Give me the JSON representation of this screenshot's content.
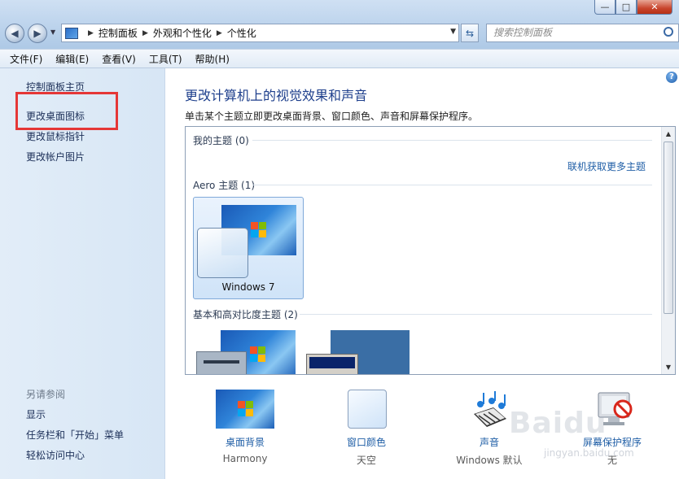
{
  "window": {
    "controls": [
      "—",
      "□",
      "✕"
    ]
  },
  "address": {
    "crumbs": [
      "控制面板",
      "外观和个性化",
      "个性化"
    ],
    "search_placeholder": "搜索控制面板"
  },
  "menubar": [
    "文件(F)",
    "编辑(E)",
    "查看(V)",
    "工具(T)",
    "帮助(H)"
  ],
  "sidebar": {
    "home": "控制面板主页",
    "links": [
      "更改桌面图标",
      "更改鼠标指针",
      "更改帐户图片"
    ],
    "see_also_heading": "另请参阅",
    "see_also": [
      "显示",
      "任务栏和「开始」菜单",
      "轻松访问中心"
    ]
  },
  "main": {
    "title": "更改计算机上的视觉效果和声音",
    "description": "单击某个主题立即更改桌面背景、窗口颜色、声音和屏幕保护程序。",
    "sections": {
      "my_themes": "我的主题 (0)",
      "get_more": "联机获取更多主题",
      "aero": "Aero 主题 (1)",
      "aero_theme_name": "Windows 7",
      "basic": "基本和高对比度主题 (2)"
    },
    "bottom": [
      {
        "label": "桌面背景",
        "value": "Harmony"
      },
      {
        "label": "窗口颜色",
        "value": "天空"
      },
      {
        "label": "声音",
        "value": "Windows 默认"
      },
      {
        "label": "屏幕保护程序",
        "value": "无"
      }
    ]
  },
  "watermark": {
    "text": "Baidu",
    "sub": "jingyan.baidu.com"
  },
  "colors": {
    "accent_link": "#1f5ea6",
    "highlight_box": "#e53737"
  }
}
